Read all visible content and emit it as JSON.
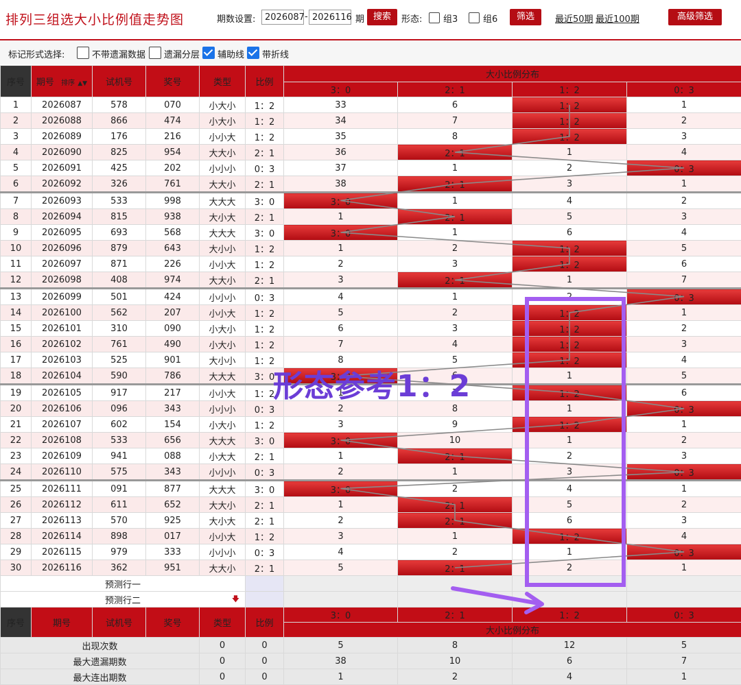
{
  "header": {
    "title": "排列三组选大小比例值走势图",
    "period_label": "期数设置:",
    "from": "2026087",
    "to": "2026116",
    "period_unit": "期",
    "search": "搜索",
    "shape_label": "形态:",
    "group3": "组3",
    "group6": "组6",
    "filter": "筛选",
    "recent50": "最近50期",
    "recent100": "最近100期",
    "advanced": "高级筛选"
  },
  "marks": {
    "label": "标记形式选择:",
    "opt1": "不带遗漏数据",
    "opt2": "遗漏分层",
    "opt3": "辅助线",
    "opt4": "带折线"
  },
  "columns": {
    "idx": "序号",
    "period": "期号",
    "sort": "排序",
    "test": "试机号",
    "draw": "奖号",
    "type": "类型",
    "ratio": "比例",
    "dist": "大小比例分布",
    "ratios": [
      "3：0",
      "2：1",
      "1：2",
      "0：3"
    ]
  },
  "rows": [
    {
      "i": "1",
      "p": "2026087",
      "t": "578",
      "d": "070",
      "ty": "小大小",
      "r": "1：2",
      "c": [
        33,
        6,
        "1：2",
        1
      ]
    },
    {
      "i": "2",
      "p": "2026088",
      "t": "866",
      "d": "474",
      "ty": "小大小",
      "r": "1：2",
      "c": [
        34,
        7,
        "1：2",
        2
      ]
    },
    {
      "i": "3",
      "p": "2026089",
      "t": "176",
      "d": "216",
      "ty": "小小大",
      "r": "1：2",
      "c": [
        35,
        8,
        "1：2",
        3
      ]
    },
    {
      "i": "4",
      "p": "2026090",
      "t": "825",
      "d": "954",
      "ty": "大大小",
      "r": "2：1",
      "c": [
        36,
        "2：1",
        1,
        4
      ]
    },
    {
      "i": "5",
      "p": "2026091",
      "t": "425",
      "d": "202",
      "ty": "小小小",
      "r": "0：3",
      "c": [
        37,
        1,
        2,
        "0：3"
      ]
    },
    {
      "i": "6",
      "p": "2026092",
      "t": "326",
      "d": "761",
      "ty": "大大小",
      "r": "2：1",
      "c": [
        38,
        "2：1",
        3,
        1
      ]
    },
    {
      "i": "7",
      "p": "2026093",
      "t": "533",
      "d": "998",
      "ty": "大大大",
      "r": "3：0",
      "c": [
        "3：0",
        1,
        4,
        2
      ]
    },
    {
      "i": "8",
      "p": "2026094",
      "t": "815",
      "d": "938",
      "ty": "大小大",
      "r": "2：1",
      "c": [
        1,
        "2：1",
        5,
        3
      ]
    },
    {
      "i": "9",
      "p": "2026095",
      "t": "693",
      "d": "568",
      "ty": "大大大",
      "r": "3：0",
      "c": [
        "3：0",
        1,
        6,
        4
      ]
    },
    {
      "i": "10",
      "p": "2026096",
      "t": "879",
      "d": "643",
      "ty": "大小小",
      "r": "1：2",
      "c": [
        1,
        2,
        "1：2",
        5
      ]
    },
    {
      "i": "11",
      "p": "2026097",
      "t": "871",
      "d": "226",
      "ty": "小小大",
      "r": "1：2",
      "c": [
        2,
        3,
        "1：2",
        6
      ]
    },
    {
      "i": "12",
      "p": "2026098",
      "t": "408",
      "d": "974",
      "ty": "大大小",
      "r": "2：1",
      "c": [
        3,
        "2：1",
        1,
        7
      ]
    },
    {
      "i": "13",
      "p": "2026099",
      "t": "501",
      "d": "424",
      "ty": "小小小",
      "r": "0：3",
      "c": [
        4,
        1,
        2,
        "0：3"
      ]
    },
    {
      "i": "14",
      "p": "2026100",
      "t": "562",
      "d": "207",
      "ty": "小小大",
      "r": "1：2",
      "c": [
        5,
        2,
        "1：2",
        1
      ]
    },
    {
      "i": "15",
      "p": "2026101",
      "t": "310",
      "d": "090",
      "ty": "小大小",
      "r": "1：2",
      "c": [
        6,
        3,
        "1：2",
        2
      ]
    },
    {
      "i": "16",
      "p": "2026102",
      "t": "761",
      "d": "490",
      "ty": "小大小",
      "r": "1：2",
      "c": [
        7,
        4,
        "1：2",
        3
      ]
    },
    {
      "i": "17",
      "p": "2026103",
      "t": "525",
      "d": "901",
      "ty": "大小小",
      "r": "1：2",
      "c": [
        8,
        5,
        "1：2",
        4
      ]
    },
    {
      "i": "18",
      "p": "2026104",
      "t": "590",
      "d": "786",
      "ty": "大大大",
      "r": "3：0",
      "c": [
        "3：0",
        6,
        1,
        5
      ]
    },
    {
      "i": "19",
      "p": "2026105",
      "t": "917",
      "d": "217",
      "ty": "小小大",
      "r": "1：2",
      "c": [
        1,
        7,
        "1：2",
        6
      ]
    },
    {
      "i": "20",
      "p": "2026106",
      "t": "096",
      "d": "343",
      "ty": "小小小",
      "r": "0：3",
      "c": [
        2,
        8,
        1,
        "0：3"
      ]
    },
    {
      "i": "21",
      "p": "2026107",
      "t": "602",
      "d": "154",
      "ty": "小大小",
      "r": "1：2",
      "c": [
        3,
        9,
        "1：2",
        1
      ]
    },
    {
      "i": "22",
      "p": "2026108",
      "t": "533",
      "d": "656",
      "ty": "大大大",
      "r": "3：0",
      "c": [
        "3：0",
        10,
        1,
        2
      ]
    },
    {
      "i": "23",
      "p": "2026109",
      "t": "941",
      "d": "088",
      "ty": "小大大",
      "r": "2：1",
      "c": [
        1,
        "2：1",
        2,
        3
      ]
    },
    {
      "i": "24",
      "p": "2026110",
      "t": "575",
      "d": "343",
      "ty": "小小小",
      "r": "0：3",
      "c": [
        2,
        1,
        3,
        "0：3"
      ]
    },
    {
      "i": "25",
      "p": "2026111",
      "t": "091",
      "d": "877",
      "ty": "大大大",
      "r": "3：0",
      "c": [
        "3：0",
        2,
        4,
        1
      ]
    },
    {
      "i": "26",
      "p": "2026112",
      "t": "611",
      "d": "652",
      "ty": "大大小",
      "r": "2：1",
      "c": [
        1,
        "2：1",
        5,
        2
      ]
    },
    {
      "i": "27",
      "p": "2026113",
      "t": "570",
      "d": "925",
      "ty": "大小大",
      "r": "2：1",
      "c": [
        2,
        "2：1",
        6,
        3
      ]
    },
    {
      "i": "28",
      "p": "2026114",
      "t": "898",
      "d": "017",
      "ty": "小小大",
      "r": "1：2",
      "c": [
        3,
        1,
        "1：2",
        4
      ]
    },
    {
      "i": "29",
      "p": "2026115",
      "t": "979",
      "d": "333",
      "ty": "小小小",
      "r": "0：3",
      "c": [
        4,
        2,
        1,
        "0：3"
      ]
    },
    {
      "i": "30",
      "p": "2026116",
      "t": "362",
      "d": "951",
      "ty": "大大小",
      "r": "2：1",
      "c": [
        5,
        "2：1",
        2,
        1
      ]
    }
  ],
  "predict": [
    "预测行一",
    "预测行二"
  ],
  "stats": [
    {
      "label": "出现次数",
      "a": "0",
      "b": "0",
      "v": [
        "5",
        "8",
        "12",
        "5"
      ]
    },
    {
      "label": "最大遗漏期数",
      "a": "0",
      "b": "0",
      "v": [
        "38",
        "10",
        "6",
        "7"
      ]
    },
    {
      "label": "最大连出期数",
      "a": "0",
      "b": "0",
      "v": [
        "1",
        "2",
        "4",
        "1"
      ]
    }
  ],
  "annotation": "形态参考1：2",
  "colors": {
    "accent": "#c20d16",
    "annotation": "#6b3dd6",
    "box": "#a35ef0"
  }
}
